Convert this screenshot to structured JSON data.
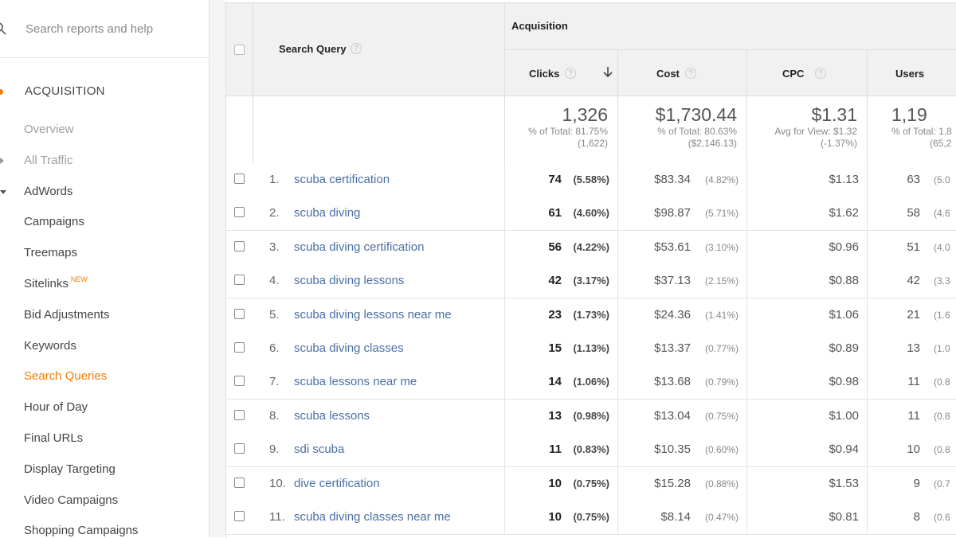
{
  "sidebar": {
    "search_placeholder": "Search reports and help",
    "section": "ACQUISITION",
    "items": [
      {
        "label": "Overview",
        "style": "muted"
      },
      {
        "label": "All Traffic",
        "style": "muted"
      },
      {
        "label": "AdWords",
        "style": "normal"
      },
      {
        "label": "Campaigns",
        "style": "normal"
      },
      {
        "label": "Treemaps",
        "style": "normal"
      },
      {
        "label": "Sitelinks",
        "badge": "NEW",
        "style": "normal"
      },
      {
        "label": "Bid Adjustments",
        "style": "normal"
      },
      {
        "label": "Keywords",
        "style": "normal"
      },
      {
        "label": "Search Queries",
        "style": "active"
      },
      {
        "label": "Hour of Day",
        "style": "normal"
      },
      {
        "label": "Final URLs",
        "style": "normal"
      },
      {
        "label": "Display Targeting",
        "style": "normal"
      },
      {
        "label": "Video Campaigns",
        "style": "normal"
      },
      {
        "label": "Shopping Campaigns",
        "style": "normal"
      }
    ]
  },
  "table": {
    "group_header": "Acquisition",
    "columns": {
      "query": "Search Query",
      "clicks": "Clicks",
      "cost": "Cost",
      "cpc": "CPC",
      "users": "Users"
    },
    "help_glyph": "?",
    "totals": {
      "clicks": {
        "value": "1,326",
        "sub1": "% of Total: 81.75%",
        "sub2": "(1,622)"
      },
      "cost": {
        "value": "$1,730.44",
        "sub1": "% of Total: 80.63%",
        "sub2": "($2,146.13)"
      },
      "cpc": {
        "value": "$1.31",
        "sub1": "Avg for View: $1.32",
        "sub2": "(-1.37%)"
      },
      "users": {
        "value": "1,19",
        "sub1": "% of Total: 1.8",
        "sub2": "(65,2"
      }
    },
    "rows": [
      {
        "index": "1.",
        "query": "scuba certification",
        "clicks": "74",
        "clicks_pct": "(5.58%)",
        "cost": "$83.34",
        "cost_pct": "(4.82%)",
        "cpc": "$1.13",
        "users": "63",
        "users_pct": "(5.0"
      },
      {
        "index": "2.",
        "query": "scuba diving",
        "clicks": "61",
        "clicks_pct": "(4.60%)",
        "cost": "$98.87",
        "cost_pct": "(5.71%)",
        "cpc": "$1.62",
        "users": "58",
        "users_pct": "(4.6"
      },
      {
        "index": "3.",
        "query": "scuba diving certification",
        "clicks": "56",
        "clicks_pct": "(4.22%)",
        "cost": "$53.61",
        "cost_pct": "(3.10%)",
        "cpc": "$0.96",
        "users": "51",
        "users_pct": "(4.0"
      },
      {
        "index": "4.",
        "query": "scuba diving lessons",
        "clicks": "42",
        "clicks_pct": "(3.17%)",
        "cost": "$37.13",
        "cost_pct": "(2.15%)",
        "cpc": "$0.88",
        "users": "42",
        "users_pct": "(3.3"
      },
      {
        "index": "5.",
        "query": "scuba diving lessons near me",
        "clicks": "23",
        "clicks_pct": "(1.73%)",
        "cost": "$24.36",
        "cost_pct": "(1.41%)",
        "cpc": "$1.06",
        "users": "21",
        "users_pct": "(1.6"
      },
      {
        "index": "6.",
        "query": "scuba diving classes",
        "clicks": "15",
        "clicks_pct": "(1.13%)",
        "cost": "$13.37",
        "cost_pct": "(0.77%)",
        "cpc": "$0.89",
        "users": "13",
        "users_pct": "(1.0"
      },
      {
        "index": "7.",
        "query": "scuba lessons near me",
        "clicks": "14",
        "clicks_pct": "(1.06%)",
        "cost": "$13.68",
        "cost_pct": "(0.79%)",
        "cpc": "$0.98",
        "users": "11",
        "users_pct": "(0.8"
      },
      {
        "index": "8.",
        "query": "scuba lessons",
        "clicks": "13",
        "clicks_pct": "(0.98%)",
        "cost": "$13.04",
        "cost_pct": "(0.75%)",
        "cpc": "$1.00",
        "users": "11",
        "users_pct": "(0.8"
      },
      {
        "index": "9.",
        "query": "sdi scuba",
        "clicks": "11",
        "clicks_pct": "(0.83%)",
        "cost": "$10.35",
        "cost_pct": "(0.60%)",
        "cpc": "$0.94",
        "users": "10",
        "users_pct": "(0.8"
      },
      {
        "index": "10.",
        "query": "dive certification",
        "clicks": "10",
        "clicks_pct": "(0.75%)",
        "cost": "$15.28",
        "cost_pct": "(0.88%)",
        "cpc": "$1.53",
        "users": "9",
        "users_pct": "(0.7"
      },
      {
        "index": "11.",
        "query": "scuba diving classes near me",
        "clicks": "10",
        "clicks_pct": "(0.75%)",
        "cost": "$8.14",
        "cost_pct": "(0.47%)",
        "cpc": "$0.81",
        "users": "8",
        "users_pct": "(0.6"
      }
    ]
  },
  "colors": {
    "accent": "#f57c00",
    "link": "#4a6fa5"
  }
}
